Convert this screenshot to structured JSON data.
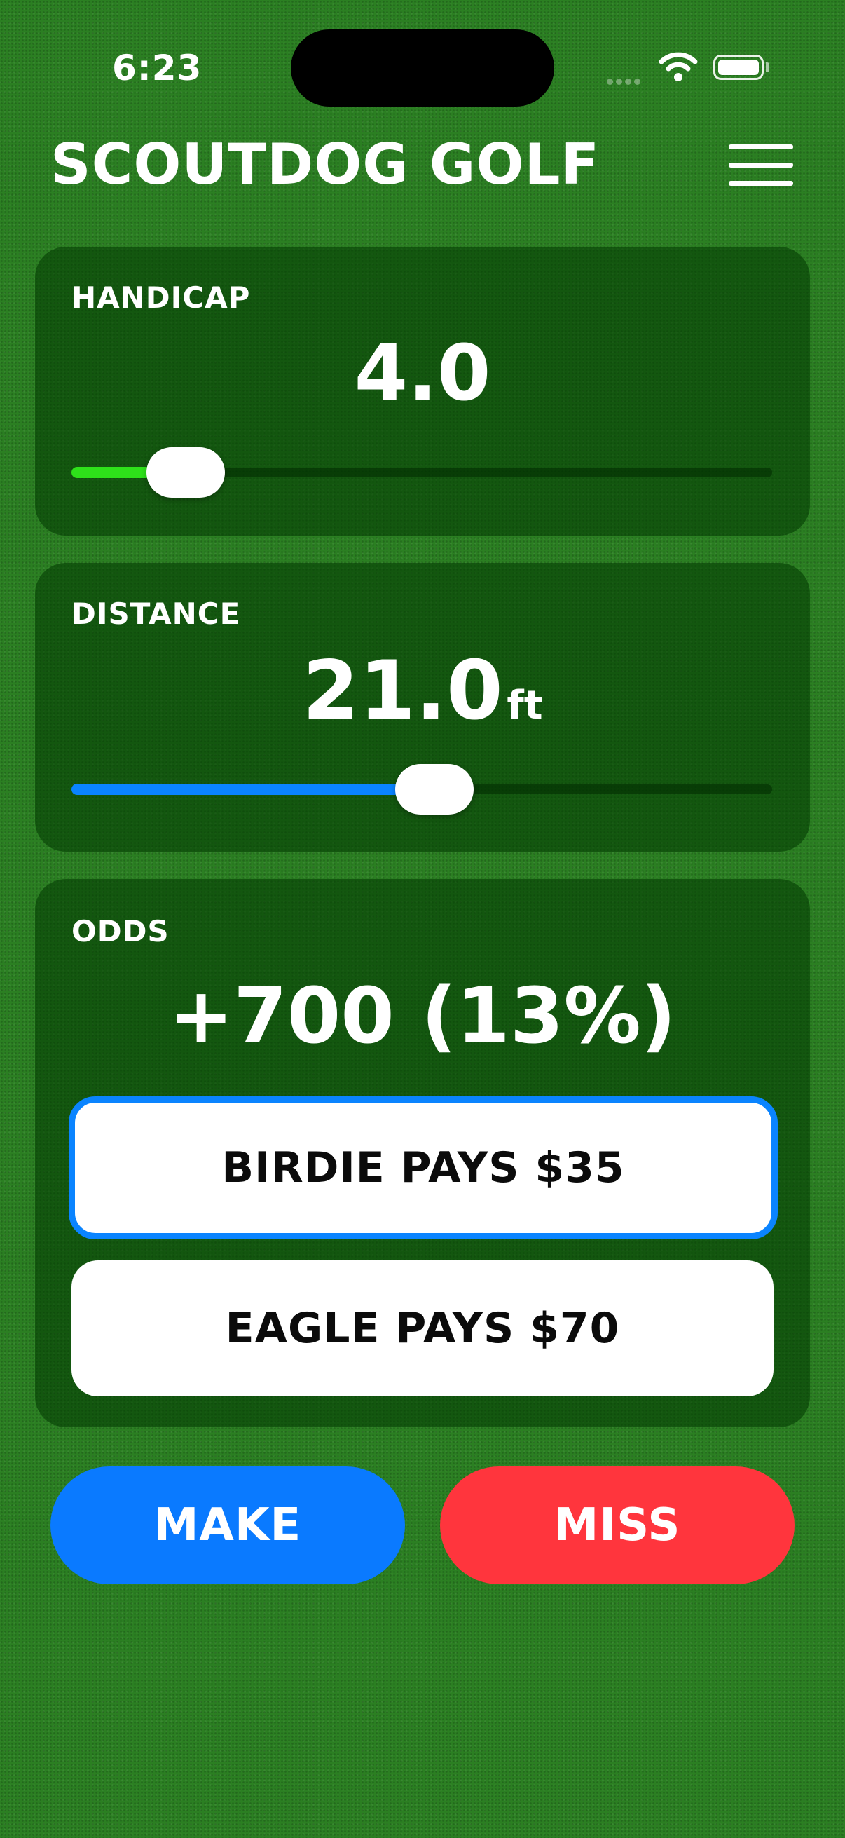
{
  "status_bar": {
    "time": "6:23"
  },
  "header": {
    "title": "SCOUTDOG GOLF",
    "menu_icon": "hamburger-menu-icon"
  },
  "handicap": {
    "label": "HANDICAP",
    "value": "4.0",
    "slider_fraction": 0.12,
    "slider_color": "#2ee11a"
  },
  "distance": {
    "label": "DISTANCE",
    "value": "21.0",
    "unit": "ft",
    "slider_fraction": 0.52,
    "slider_color": "#0a84ff"
  },
  "odds": {
    "label": "ODDS",
    "value": "+700 (13%)",
    "options": [
      {
        "label": "BIRDIE PAYS $35",
        "selected": true
      },
      {
        "label": "EAGLE PAYS $70",
        "selected": false
      }
    ],
    "selected_border_color": "#0a84ff"
  },
  "actions": {
    "make_label": "MAKE",
    "make_color": "#0a7aff",
    "miss_label": "MISS",
    "miss_color": "#ff353d"
  }
}
